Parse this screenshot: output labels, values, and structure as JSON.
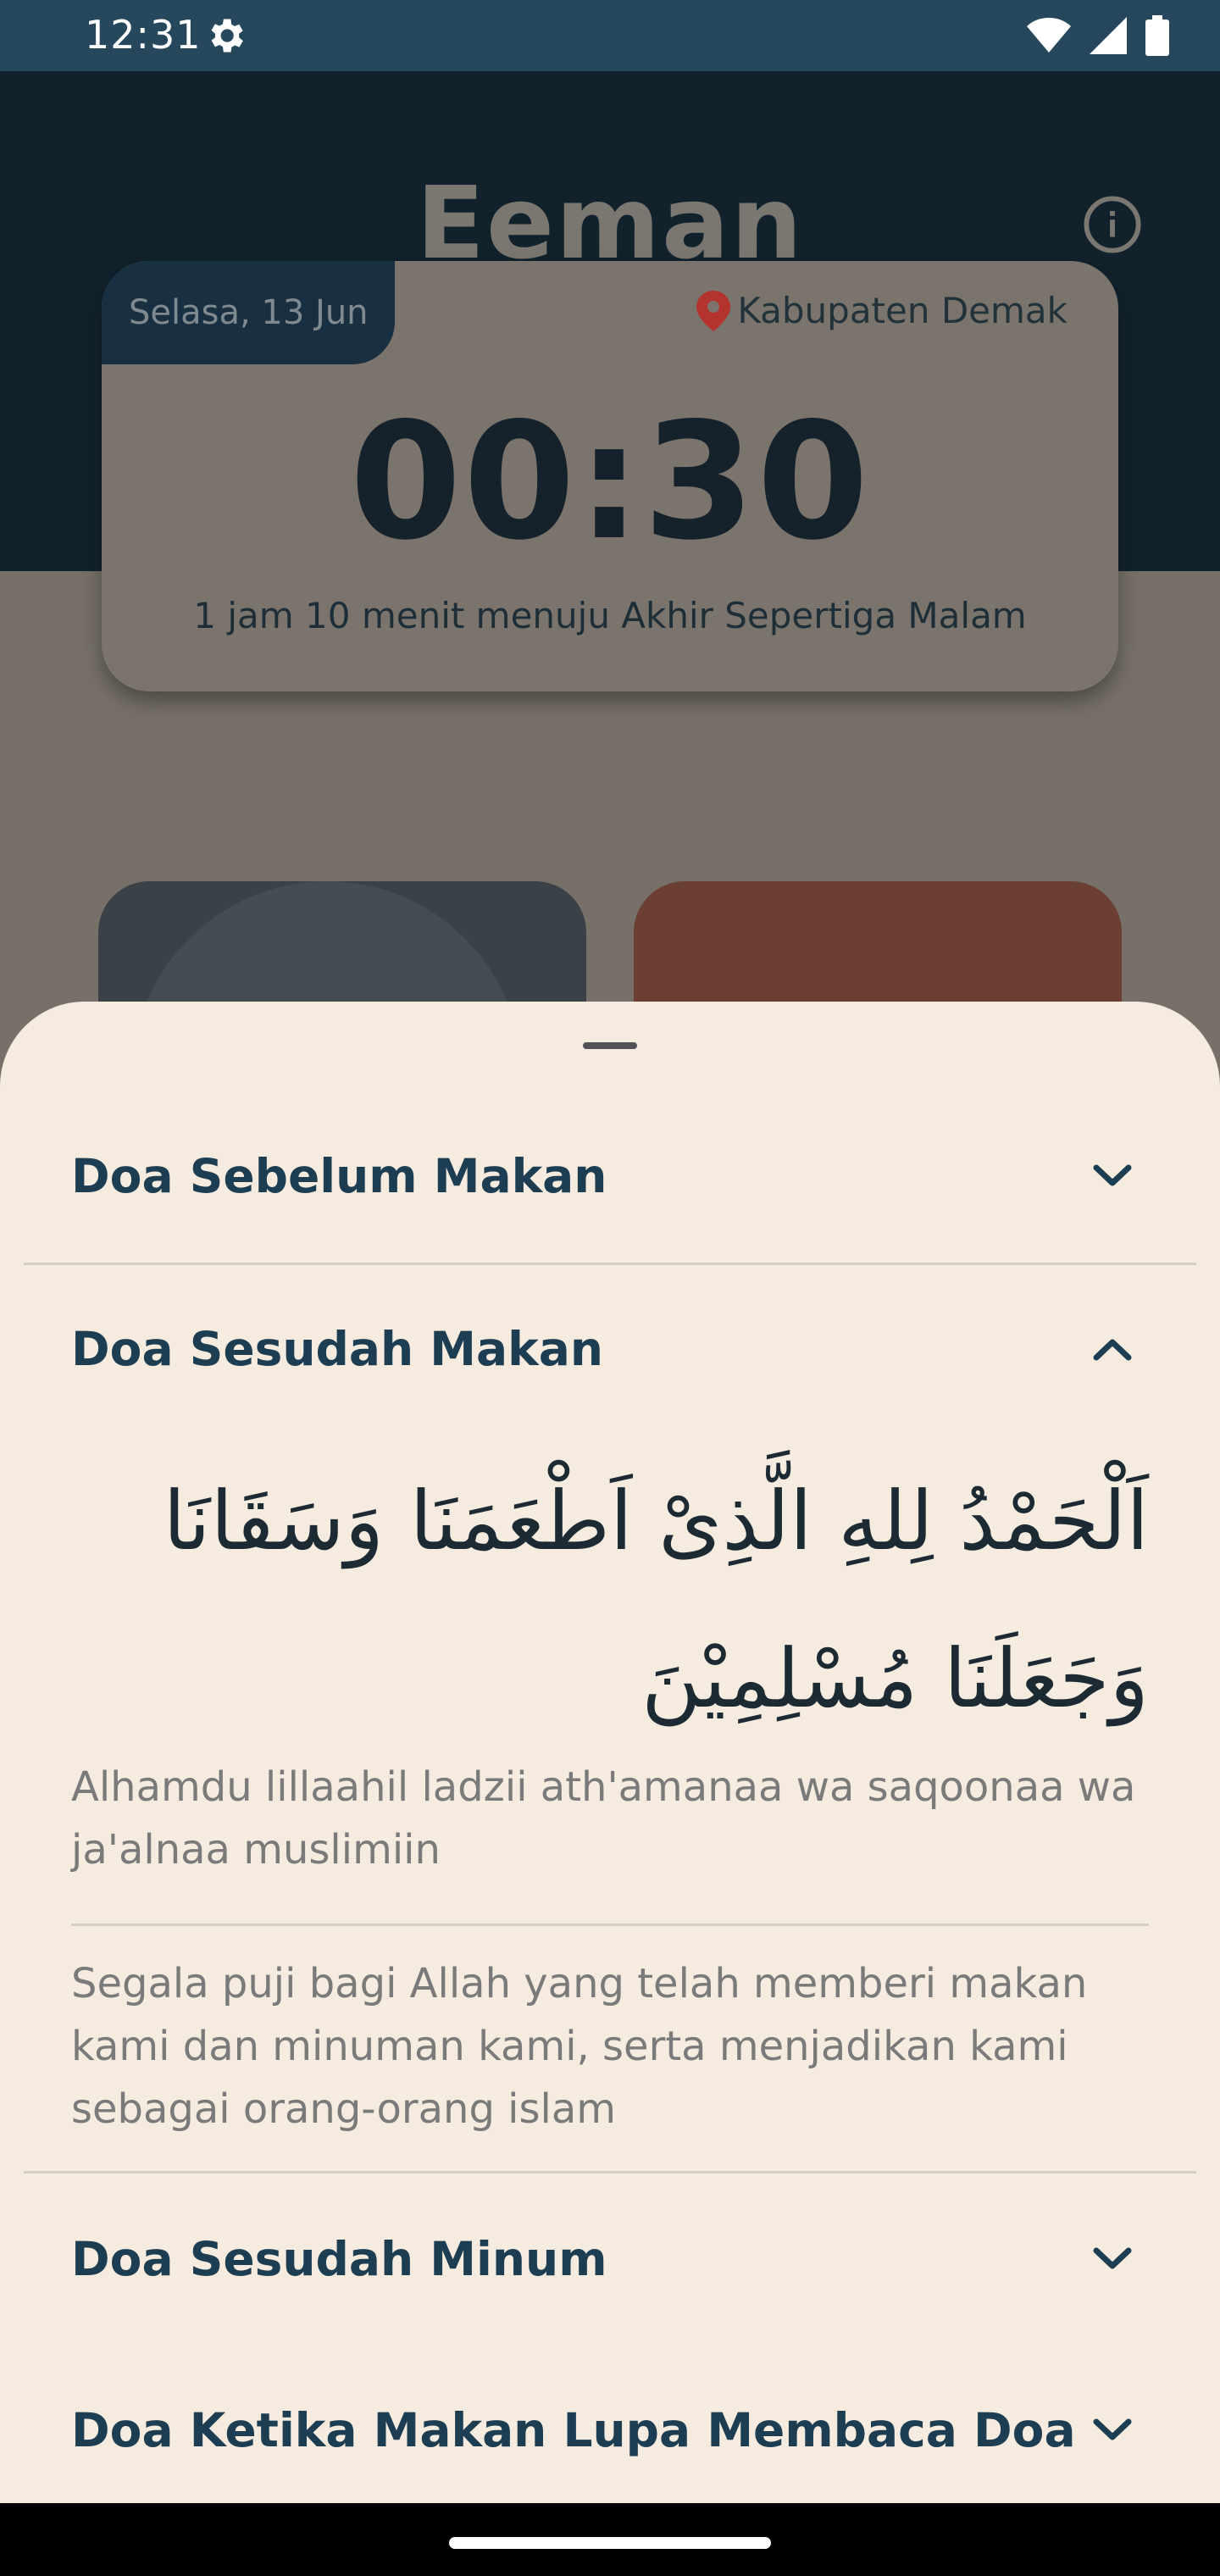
{
  "status_bar": {
    "time": "12:31",
    "icons": [
      "gear-icon",
      "wifi-icon",
      "signal-icon",
      "battery-icon"
    ]
  },
  "header": {
    "app_title": "Eeman",
    "info_icon": "info-icon"
  },
  "time_card": {
    "date": "Selasa, 13 Jun",
    "location": "Kabupaten Demak",
    "time": "00:30",
    "countdown": "1 jam 10 menit menuju Akhir Sepertiga Malam"
  },
  "sheet": {
    "items": [
      {
        "title": "Doa Sebelum Makan",
        "expanded": false
      },
      {
        "title": "Doa Sesudah Makan",
        "expanded": true,
        "arabic": "اَلْحَمْدُ لِلهِ الَّذِىْ اَطْعَمَنَا وَسَقَانَا وَجَعَلَنَا مُسْلِمِيْنَ",
        "latin": "Alhamdu lillaahil ladzii ath'amanaa wa saqoonaa wa ja'alnaa muslimiin",
        "translation": "Segala puji bagi Allah yang telah memberi makan kami dan minuman kami, serta menjadikan kami sebagai orang-orang islam"
      },
      {
        "title": "Doa Sesudah  Minum",
        "expanded": false
      },
      {
        "title": "Doa Ketika Makan Lupa Membaca Doa",
        "expanded": false
      }
    ]
  },
  "colors": {
    "status_bar": "#26475c",
    "sheet_bg": "#f5ebdf",
    "title_text": "#1d3d52",
    "body_text": "#7a7a7a",
    "location_pin": "#b5332f"
  }
}
